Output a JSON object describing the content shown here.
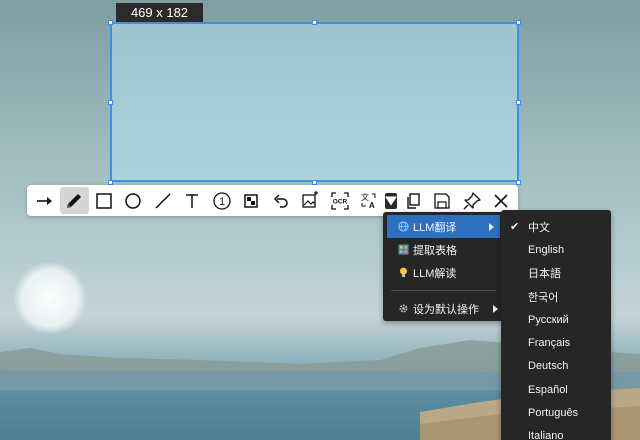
{
  "selection": {
    "size_label": "469 x 182"
  },
  "toolbar": {
    "tools": [
      {
        "name": "arrow-tool",
        "icon": "arrow-right-icon"
      },
      {
        "name": "pen-tool",
        "icon": "pencil-icon",
        "active": true
      },
      {
        "name": "rectangle-tool",
        "icon": "rectangle-icon"
      },
      {
        "name": "ellipse-tool",
        "icon": "circle-icon"
      },
      {
        "name": "line-tool",
        "icon": "line-icon"
      },
      {
        "name": "text-tool",
        "icon": "text-icon"
      },
      {
        "name": "number-tool",
        "icon": "numbered-circle-icon",
        "label": "1"
      },
      {
        "name": "mosaic-tool",
        "icon": "mosaic-icon"
      },
      {
        "name": "undo-tool",
        "icon": "undo-icon"
      },
      {
        "name": "image-tool",
        "icon": "image-edit-icon"
      },
      {
        "name": "ocr-tool",
        "icon": "ocr-icon",
        "label": "OCR"
      },
      {
        "name": "translate-tool",
        "icon": "translate-icon"
      },
      {
        "name": "translate-dropdown",
        "icon": "caret-down-icon"
      },
      {
        "name": "copy-tool",
        "icon": "copy-icon"
      },
      {
        "name": "save-tool",
        "icon": "save-icon"
      },
      {
        "name": "pin-tool",
        "icon": "pin-icon"
      },
      {
        "name": "close-tool",
        "icon": "close-icon"
      }
    ]
  },
  "menu": {
    "items": [
      {
        "label": "LLM翻译",
        "icon": "globe-icon",
        "has_submenu": true,
        "highlighted": true
      },
      {
        "label": "提取表格",
        "icon": "table-icon"
      },
      {
        "label": "LLM解读",
        "icon": "lightbulb-icon"
      },
      {
        "label": "设为默认操作",
        "icon": "gear-icon",
        "has_submenu": true
      }
    ]
  },
  "languages": {
    "selected": "中文",
    "items": [
      "中文",
      "English",
      "日本語",
      "한국어",
      "Русский",
      "Français",
      "Deutsch",
      "Español",
      "Português",
      "Italiano"
    ]
  },
  "colors": {
    "accent": "#3d8ee6",
    "menu_bg": "#262626",
    "menu_highlight": "#2f6fc0"
  }
}
